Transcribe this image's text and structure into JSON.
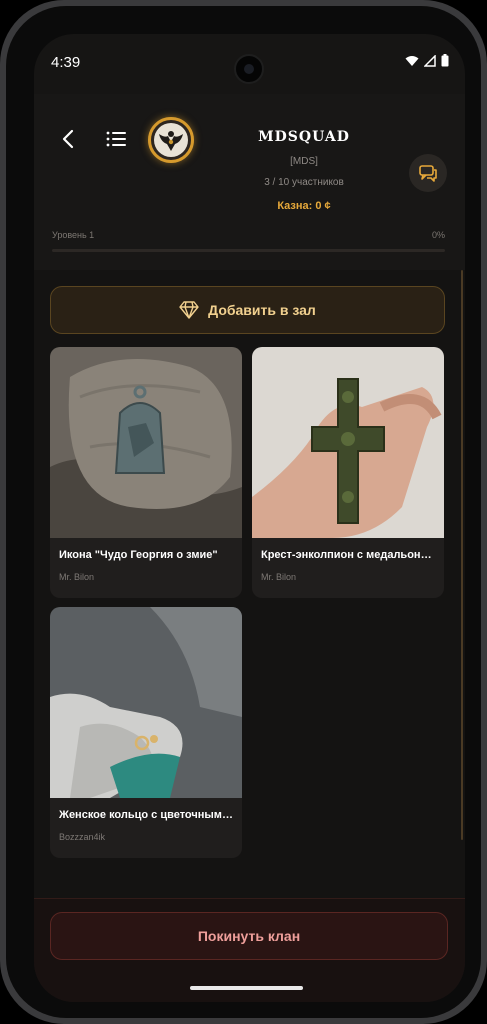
{
  "status_bar": {
    "time": "4:39",
    "icons": [
      "wifi-icon",
      "signal-icon",
      "battery-icon"
    ]
  },
  "header": {
    "back_icon": "chevron-left-icon",
    "menu_icon": "list-icon",
    "clan_name": "MDSQUAD",
    "clan_tag": "[MDS]",
    "members": "3 / 10 участников",
    "treasury": "Казна: 0 ¢",
    "chat_icon": "chat-icon",
    "level_label": "Уровень 1",
    "level_percent": "0%",
    "level_progress": 0
  },
  "add_button": {
    "label": "Добавить в зал",
    "icon": "diamond-icon"
  },
  "items": [
    {
      "title": "Икона \"Чудо Георгия о змие\"",
      "author": "Mr. Bilon"
    },
    {
      "title": "Крест-энколпион с медальонами",
      "author": "Mr. Bilon"
    },
    {
      "title": "Женское кольцо с цветочным орнаментом",
      "author": "Bozzzan4ik"
    }
  ],
  "leave_button": {
    "label": "Покинуть клан"
  },
  "colors": {
    "accent": "#d69a2d",
    "danger": "#ef9f9b",
    "background": "#161514"
  }
}
